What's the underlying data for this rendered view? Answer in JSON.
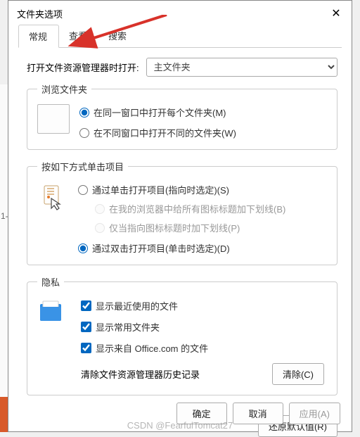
{
  "title": "文件夹选项",
  "tabs": {
    "general": "常规",
    "view": "查看",
    "search": "搜索"
  },
  "open_in_label": "打开文件资源管理器时打开:",
  "open_in_value": "主文件夹",
  "browse": {
    "legend": "浏览文件夹",
    "same_window": "在同一窗口中打开每个文件夹(M)",
    "diff_window": "在不同窗口中打开不同的文件夹(W)"
  },
  "click": {
    "legend": "按如下方式单击项目",
    "single": "通过单击打开项目(指向时选定)(S)",
    "underline_all": "在我的浏览器中给所有图标标题加下划线(B)",
    "underline_point": "仅当指向图标标题时加下划线(P)",
    "double": "通过双击打开项目(单击时选定)(D)"
  },
  "privacy": {
    "legend": "隐私",
    "recent_files": "显示最近使用的文件",
    "frequent_folders": "显示常用文件夹",
    "office_files": "显示来自 Office.com 的文件",
    "clear_label": "清除文件资源管理器历史记录",
    "clear_btn": "清除(C)"
  },
  "restore_defaults": "还原默认值(R)",
  "ok": "确定",
  "cancel": "取消",
  "apply": "应用(A)",
  "watermark": "CSDN @FearfulTomcat27"
}
